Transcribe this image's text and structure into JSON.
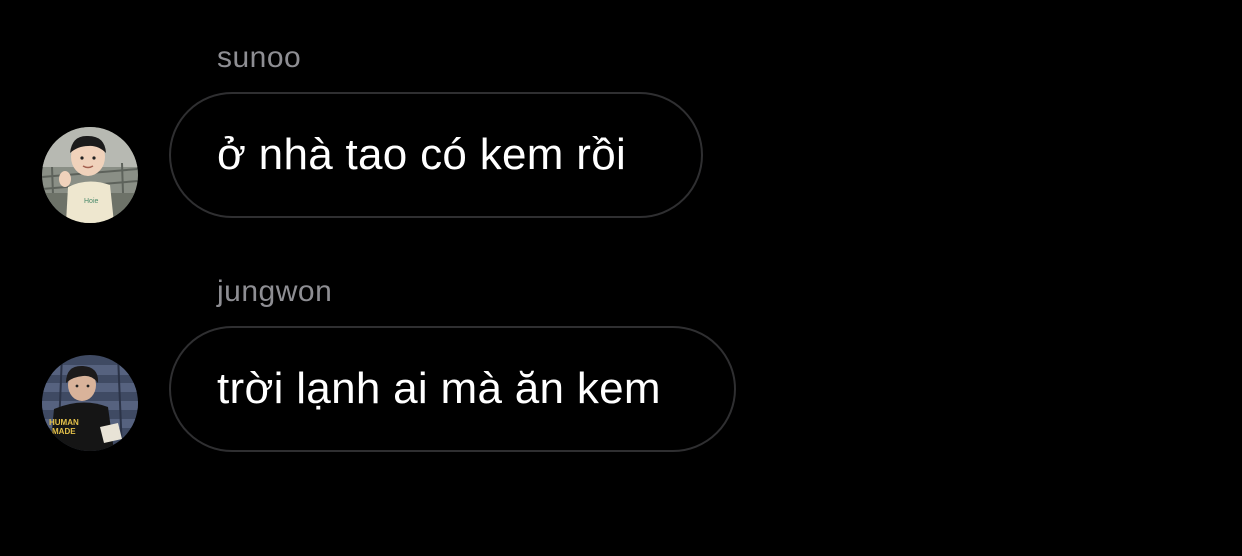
{
  "messages": [
    {
      "sender": "sunoo",
      "text": "ở nhà tao có kem rồi",
      "avatar_icon": "child-photo-avatar"
    },
    {
      "sender": "jungwon",
      "text": "trời lạnh ai mà ăn kem",
      "avatar_icon": "person-photo-avatar",
      "avatar_shirt_text": "HUMAN MADE"
    }
  ],
  "colors": {
    "background": "#000000",
    "bubble_border": "#2f2f31",
    "sender_name": "#8e8e93",
    "message_text": "#ffffff"
  }
}
